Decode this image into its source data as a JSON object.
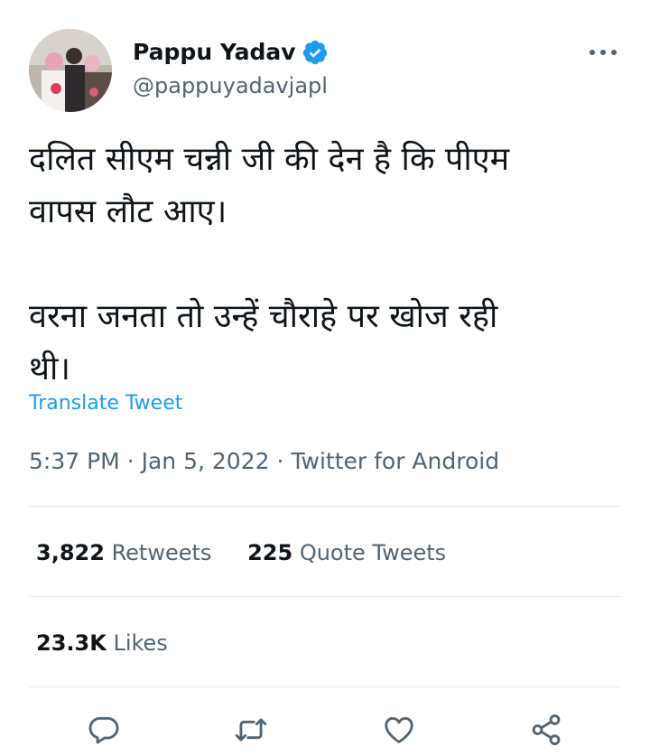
{
  "author": {
    "display_name": "Pappu Yadav",
    "handle": "@pappuyadavjapl",
    "verified": true,
    "avatar_icon": "profile-photo"
  },
  "tweet": {
    "paragraphs": [
      "दलित सीएम चन्नी जी की देन है कि पीएम\nवापस लौट आए।",
      "वरना जनता तो उन्हें चौराहे पर खोज रही\nथी।"
    ],
    "translate_label": "Translate Tweet",
    "time": "5:37 PM",
    "separator": "·",
    "date": "Jan 5, 2022",
    "source": "Twitter for Android"
  },
  "stats": {
    "retweets_count": "3,822",
    "retweets_label": "Retweets",
    "quote_count": "225",
    "quote_label": "Quote Tweets",
    "likes_count": "23.3K",
    "likes_label": "Likes"
  },
  "colors": {
    "accent": "#1d9bf0",
    "text": "#0f1419",
    "muted": "#536471",
    "divider": "#e6e9ec"
  },
  "icons": [
    "verified-badge-icon",
    "more-icon",
    "reply-icon",
    "retweet-icon",
    "like-icon",
    "share-icon"
  ]
}
